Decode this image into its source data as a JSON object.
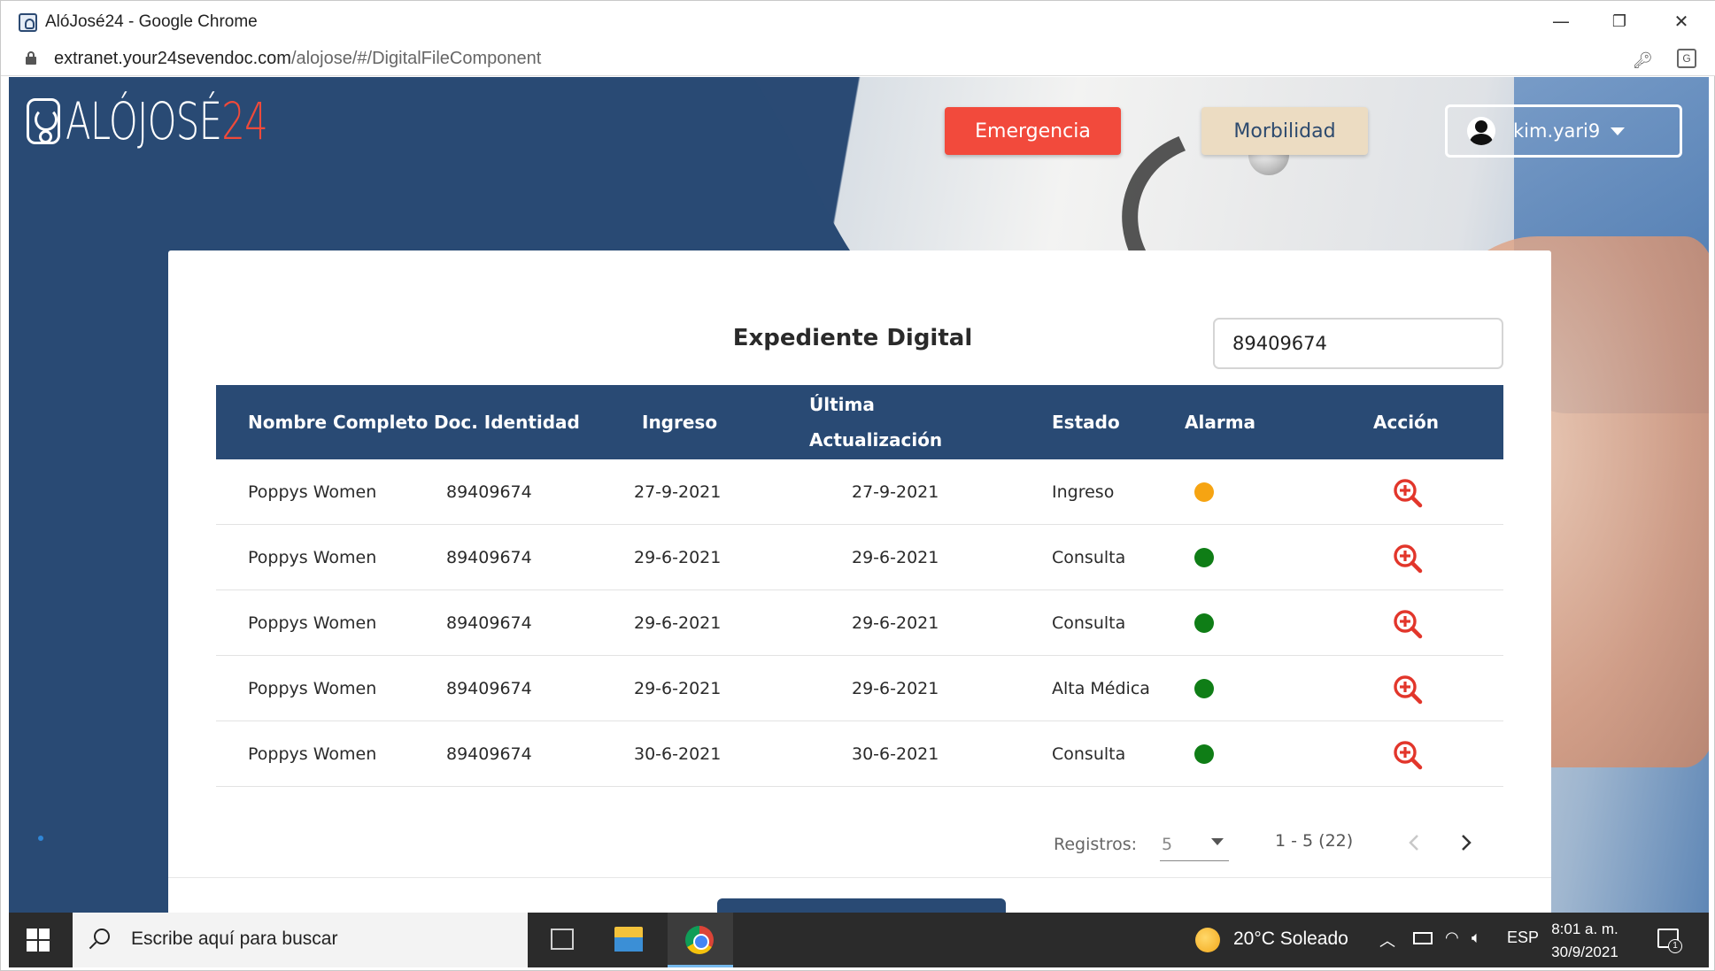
{
  "window": {
    "title": "AlóJosé24 - Google Chrome",
    "url_host": "extranet.your24sevendoc.com",
    "url_path": "/alojose/#/DigitalFileComponent",
    "minimize": "—",
    "restore": "❐",
    "close": "✕"
  },
  "header": {
    "logo_text": "ALÓJOSÉ",
    "logo_num": "24",
    "emergency_label": "Emergencia",
    "morbidity_label": "Morbilidad",
    "username": "kim.yari9"
  },
  "card": {
    "title": "Expediente Digital",
    "search_value": "89409674"
  },
  "table": {
    "columns": {
      "name": "Nombre Completo",
      "doc": "Doc. Identidad",
      "ingreso": "Ingreso",
      "ultima_1": "Última",
      "ultima_2": "Actualización",
      "estado": "Estado",
      "alarma": "Alarma",
      "accion": "Acción"
    },
    "rows": [
      {
        "name": "Poppys Women",
        "doc": "89409674",
        "ingreso": "27-9-2021",
        "ultima": "27-9-2021",
        "estado": "Ingreso",
        "alarm_color": "#f6a412"
      },
      {
        "name": "Poppys Women",
        "doc": "89409674",
        "ingreso": "29-6-2021",
        "ultima": "29-6-2021",
        "estado": "Consulta",
        "alarm_color": "#0f7d16"
      },
      {
        "name": "Poppys Women",
        "doc": "89409674",
        "ingreso": "29-6-2021",
        "ultima": "29-6-2021",
        "estado": "Consulta",
        "alarm_color": "#0f7d16"
      },
      {
        "name": "Poppys Women",
        "doc": "89409674",
        "ingreso": "29-6-2021",
        "ultima": "29-6-2021",
        "estado": "Alta Médica",
        "alarm_color": "#0f7d16"
      },
      {
        "name": "Poppys Women",
        "doc": "89409674",
        "ingreso": "30-6-2021",
        "ultima": "30-6-2021",
        "estado": "Consulta",
        "alarm_color": "#0f7d16"
      }
    ],
    "action_icon": "zoom-in-icon",
    "action_color": "#e2362b"
  },
  "pager": {
    "label": "Registros:",
    "page_size": "5",
    "range": "1 - 5 (22)"
  },
  "taskbar": {
    "search_placeholder": "Escribe aquí para buscar",
    "weather": "20°C  Soleado",
    "lang": "ESP",
    "time": "8:01 a. m.",
    "date": "30/9/2021",
    "notif_count": "1"
  },
  "colors": {
    "brand_blue": "#294a74",
    "emergency_red": "#f24a3c",
    "morbidity_beige": "#ecdcc2"
  }
}
